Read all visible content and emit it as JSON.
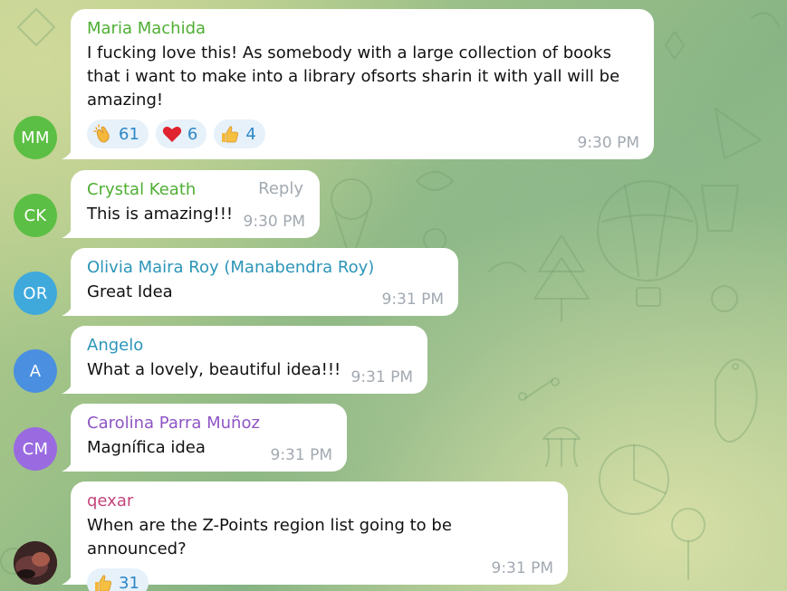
{
  "colors": {
    "bubble": "#ffffff",
    "time": "#a2a9b1",
    "reaction_bg": "#e6f1fa",
    "reaction_text": "#2e87c5"
  },
  "messages": [
    {
      "sender": "Maria Machida",
      "sender_color": "#4fae33",
      "avatar_initials": "MM",
      "avatar_color": "#5cbf45",
      "text": "I fucking love this! As somebody with a large collection of books that i want to make into a library ofsorts sharin it with yall will be amazing!",
      "time": "9:30 PM",
      "reactions": [
        {
          "emoji": "clapping-hands-icon",
          "count": "61"
        },
        {
          "emoji": "red-heart-icon",
          "count": "6"
        },
        {
          "emoji": "thumbs-up-icon",
          "count": "4"
        }
      ]
    },
    {
      "sender": "Crystal Keath",
      "sender_color": "#4fae33",
      "avatar_initials": "CK",
      "avatar_color": "#5cbf45",
      "text": "This is amazing!!!",
      "time": "9:30 PM",
      "reply_label": "Reply"
    },
    {
      "sender": "Olivia Maira Roy (Manabendra Roy)",
      "sender_color": "#2c95b8",
      "avatar_initials": "OR",
      "avatar_color": "#3fa9dc",
      "text": "Great Idea",
      "time": "9:31 PM"
    },
    {
      "sender": "Angelo",
      "sender_color": "#2c95b8",
      "avatar_initials": "A",
      "avatar_color": "#4a8fe0",
      "text": "What a lovely, beautiful idea!!!",
      "time": "9:31 PM"
    },
    {
      "sender": "Carolina Parra Muñoz",
      "sender_color": "#8e55c5",
      "avatar_initials": "CM",
      "avatar_color": "#9a6be0",
      "text": "Magnífica idea",
      "time": "9:31 PM"
    },
    {
      "sender": "qexar",
      "sender_color": "#c5457b",
      "avatar_initials": "",
      "avatar_color": "#4a2b2b",
      "text": "When are the Z-Points region list going to be announced?",
      "time": "9:31 PM",
      "reactions": [
        {
          "emoji": "thumbs-up-icon",
          "count": "31"
        }
      ]
    }
  ]
}
